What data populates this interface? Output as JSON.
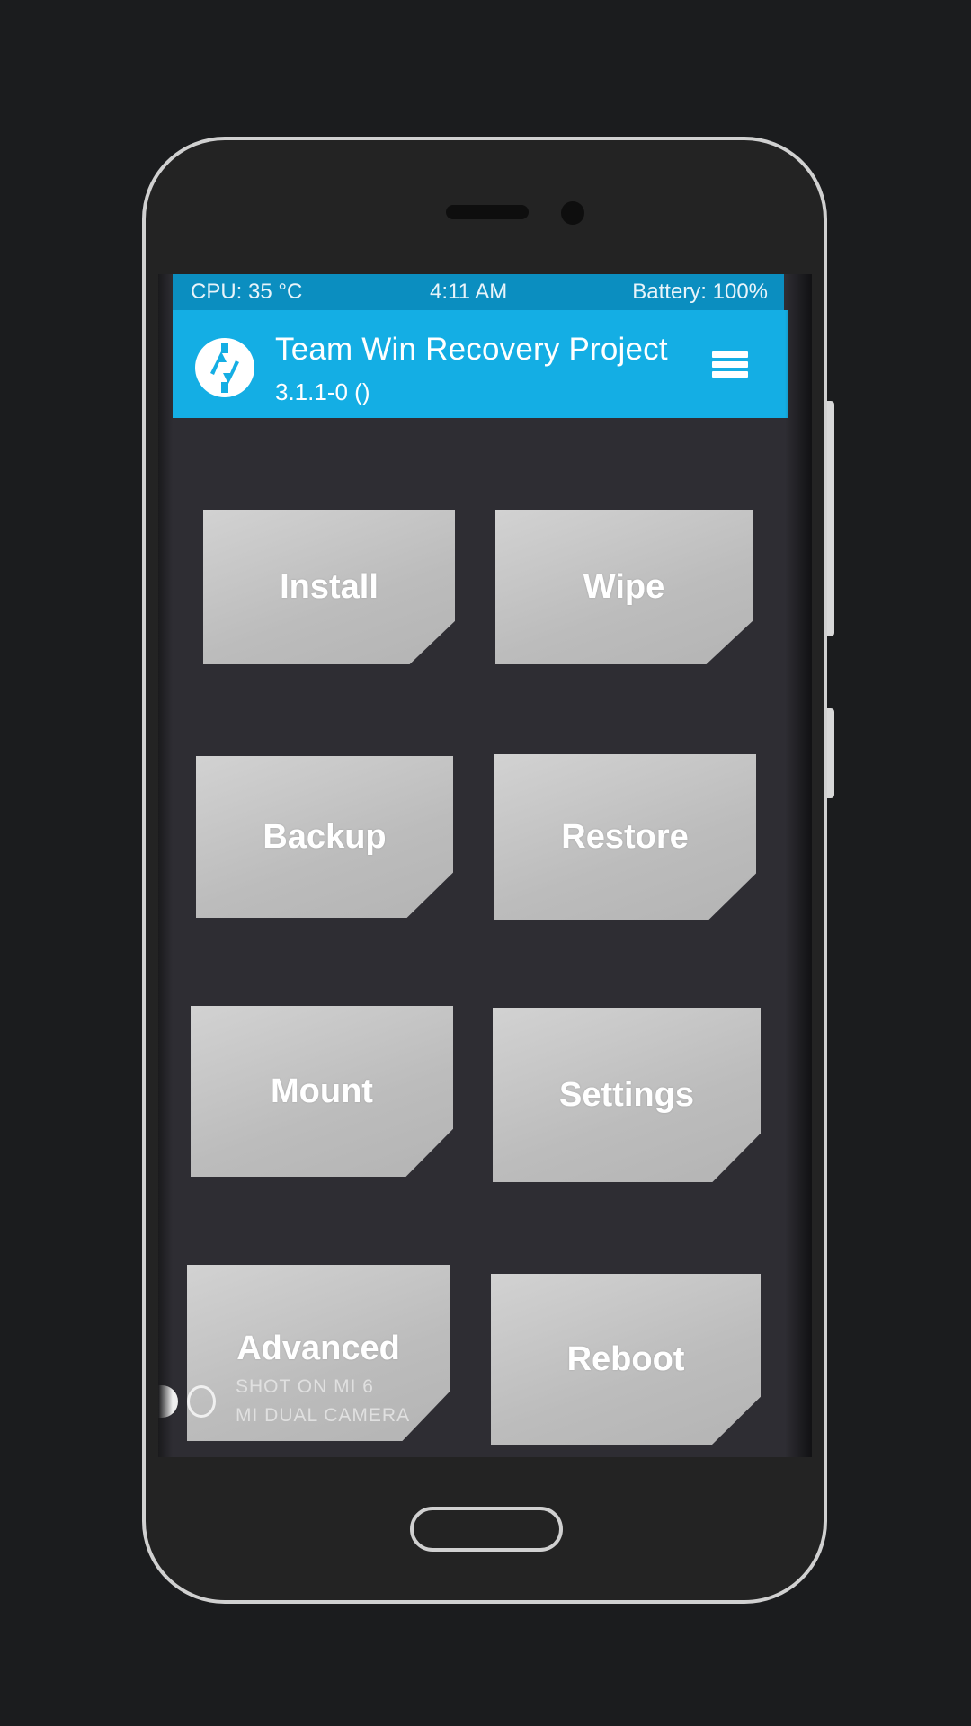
{
  "status_bar": {
    "cpu": "CPU: 35 °C",
    "time": "4:11 AM",
    "battery": "Battery: 100%"
  },
  "header": {
    "title": "Team Win Recovery Project",
    "version": "3.1.1-0 ()",
    "logo_icon": "twrp-logo-icon",
    "menu_icon": "hamburger-menu-icon"
  },
  "menu": {
    "install": "Install",
    "wipe": "Wipe",
    "backup": "Backup",
    "restore": "Restore",
    "mount": "Mount",
    "settings": "Settings",
    "advanced": "Advanced",
    "reboot": "Reboot"
  },
  "watermark": {
    "line1": "SHOT ON MI 6",
    "line2": "MI DUAL CAMERA"
  },
  "colors": {
    "header_blue": "#14aee4",
    "status_blue": "#0b8ec0",
    "tile_gray": "#c4c4c4",
    "screen_bg": "#2e2d33"
  }
}
